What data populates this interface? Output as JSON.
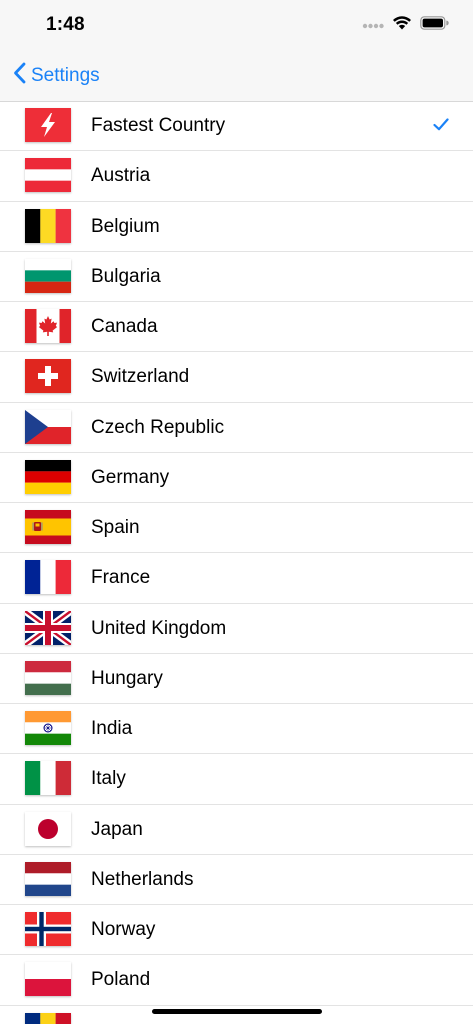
{
  "status_bar": {
    "time": "1:48"
  },
  "nav": {
    "back_label": "Settings"
  },
  "countries": [
    {
      "label": "Fastest Country",
      "flag": "fastest-icon",
      "selected": true
    },
    {
      "label": "Austria",
      "flag": "at"
    },
    {
      "label": "Belgium",
      "flag": "be"
    },
    {
      "label": "Bulgaria",
      "flag": "bg"
    },
    {
      "label": "Canada",
      "flag": "ca"
    },
    {
      "label": "Switzerland",
      "flag": "ch"
    },
    {
      "label": "Czech Republic",
      "flag": "cz"
    },
    {
      "label": "Germany",
      "flag": "de"
    },
    {
      "label": "Spain",
      "flag": "es"
    },
    {
      "label": "France",
      "flag": "fr"
    },
    {
      "label": "United Kingdom",
      "flag": "gb"
    },
    {
      "label": "Hungary",
      "flag": "hu"
    },
    {
      "label": "India",
      "flag": "in"
    },
    {
      "label": "Italy",
      "flag": "it"
    },
    {
      "label": "Japan",
      "flag": "jp"
    },
    {
      "label": "Netherlands",
      "flag": "nl"
    },
    {
      "label": "Norway",
      "flag": "no"
    },
    {
      "label": "Poland",
      "flag": "pl"
    },
    {
      "label": "",
      "flag": "ro"
    }
  ],
  "colors": {
    "accent": "#1a82f7"
  }
}
